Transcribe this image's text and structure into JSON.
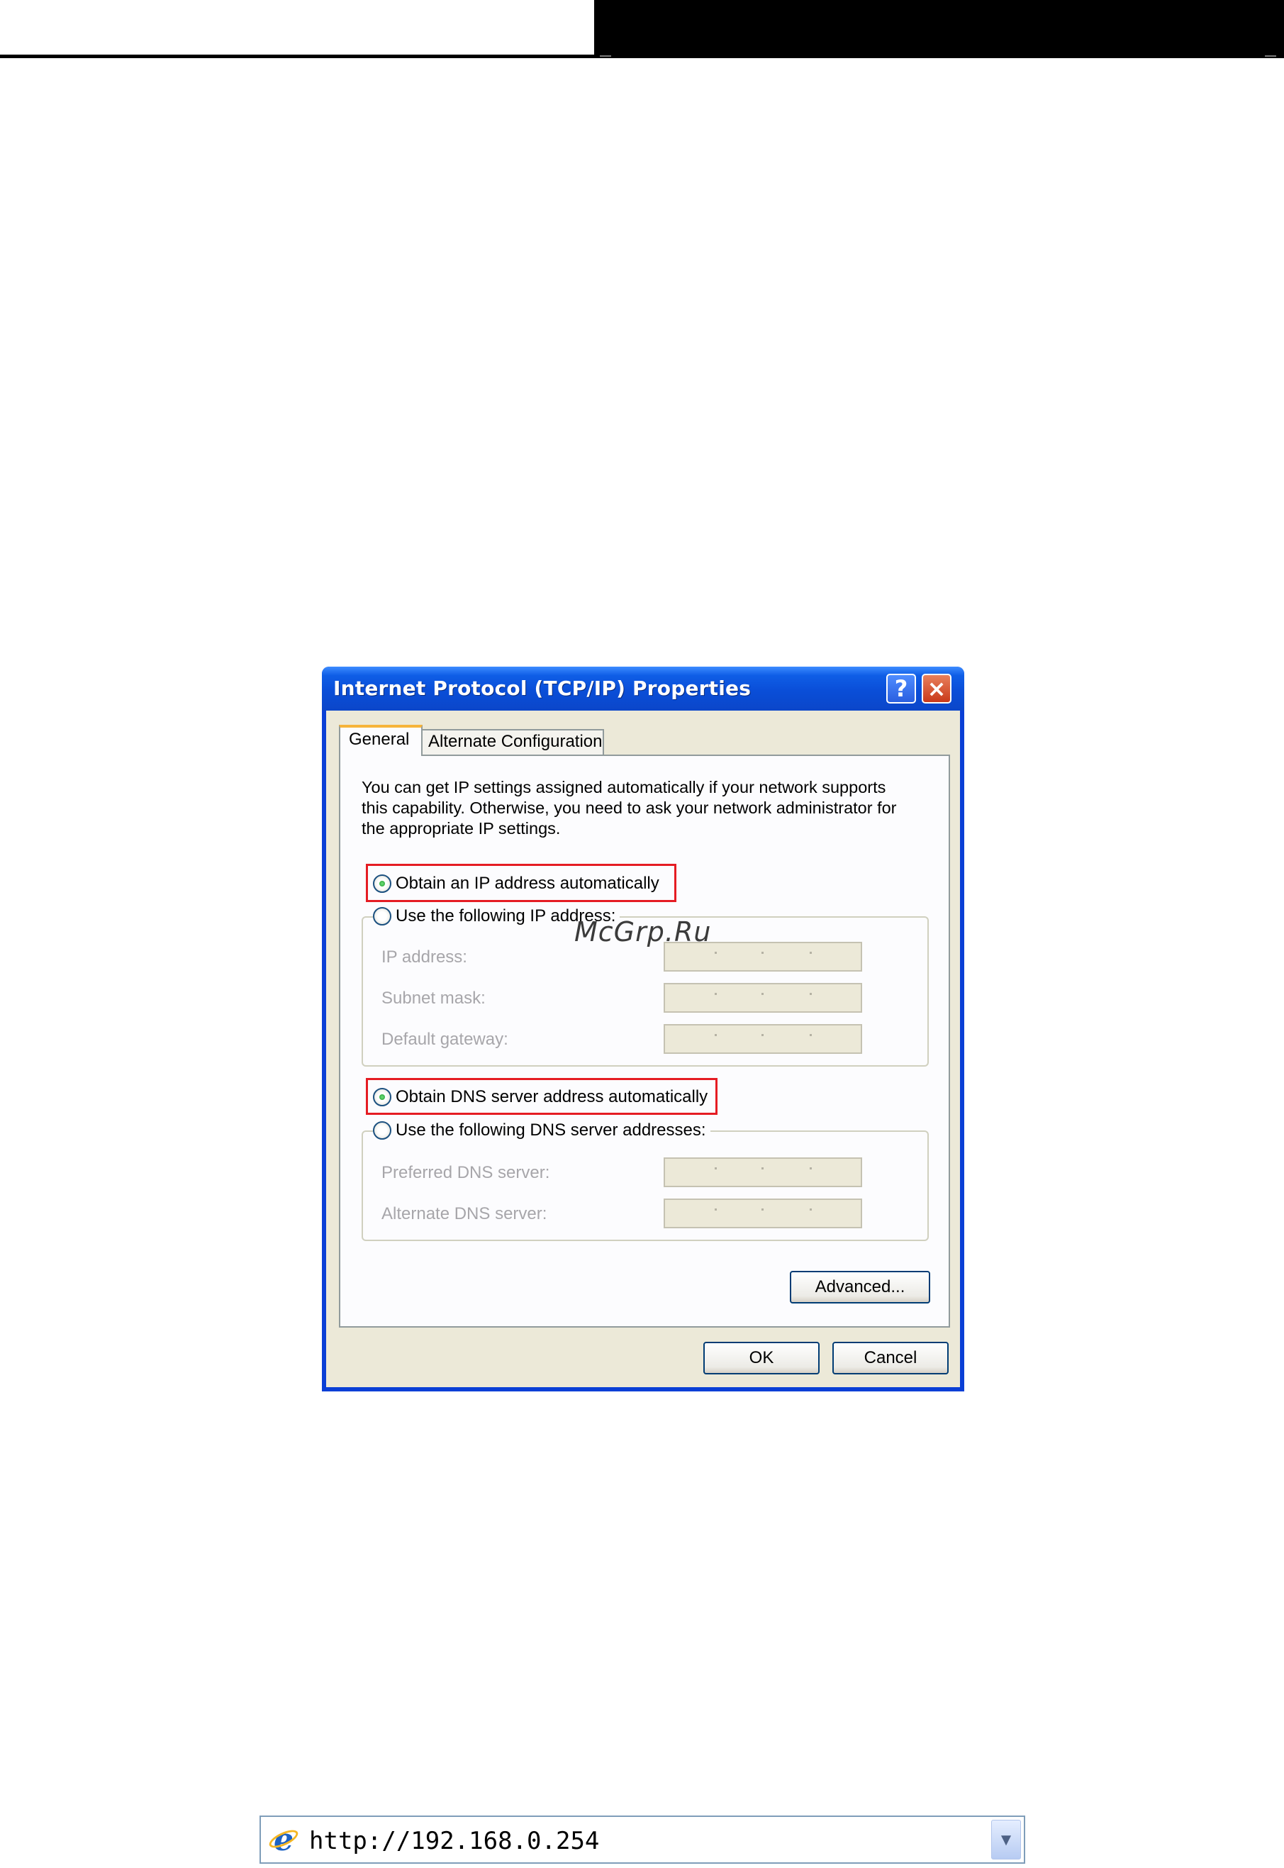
{
  "dialog": {
    "title": "Internet Protocol (TCP/IP) Properties",
    "help_label": "?",
    "close_label": "×",
    "tabs": [
      {
        "label": "General",
        "active": true
      },
      {
        "label": "Alternate Configuration",
        "active": false
      }
    ],
    "description_lines": [
      "You can get IP settings assigned automatically if your network supports",
      "this capability. Otherwise, you need to ask your network administrator for",
      "the appropriate IP settings."
    ],
    "ip_options": {
      "auto_label": "Obtain an IP address automatically",
      "auto_selected": true,
      "manual_label": "Use the following IP address:",
      "manual_selected": false
    },
    "ip_fields": [
      {
        "label": "IP address:"
      },
      {
        "label": "Subnet mask:"
      },
      {
        "label": "Default gateway:"
      }
    ],
    "dns_options": {
      "auto_label": "Obtain DNS server address automatically",
      "auto_selected": true,
      "manual_label": "Use the following DNS server addresses:",
      "manual_selected": false
    },
    "dns_fields": [
      {
        "label": "Preferred DNS server:"
      },
      {
        "label": "Alternate DNS server:"
      }
    ],
    "advanced_label": "Advanced...",
    "ok_label": "OK",
    "cancel_label": "Cancel"
  },
  "highlight_color": "#e51c23",
  "watermark": "McGrp.Ru",
  "address_bar": {
    "url": "http://192.168.0.254",
    "icon": "ie-browser-icon",
    "dropdown_icon": "chevron-down-icon"
  }
}
